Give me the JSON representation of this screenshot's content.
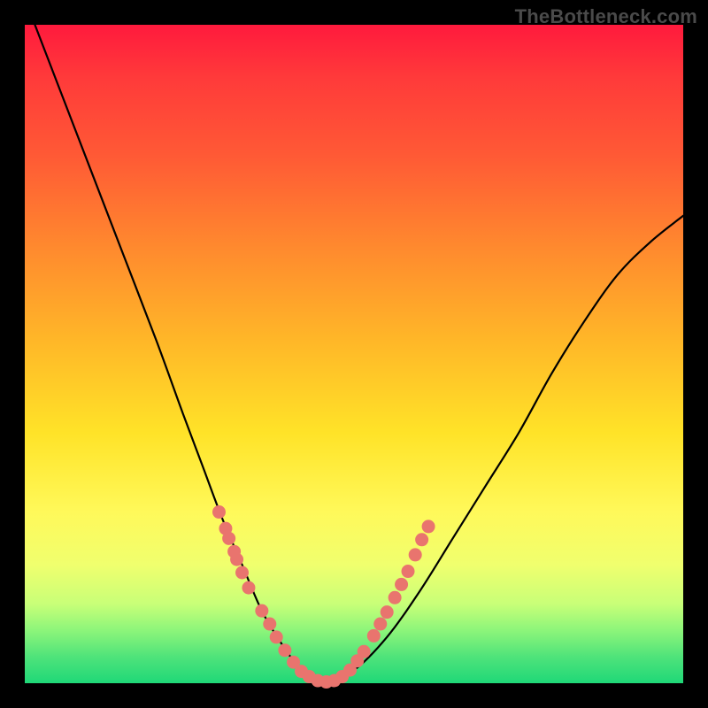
{
  "watermark": "TheBottleneck.com",
  "chart_data": {
    "type": "line",
    "title": "",
    "xlabel": "",
    "ylabel": "",
    "xlim": [
      0,
      1
    ],
    "ylim": [
      0,
      1
    ],
    "series": [
      {
        "name": "bottleneck-curve",
        "x": [
          0.0,
          0.05,
          0.1,
          0.15,
          0.2,
          0.24,
          0.27,
          0.3,
          0.33,
          0.36,
          0.39,
          0.42,
          0.45,
          0.5,
          0.55,
          0.6,
          0.65,
          0.7,
          0.75,
          0.8,
          0.85,
          0.9,
          0.95,
          1.0
        ],
        "y": [
          1.04,
          0.91,
          0.78,
          0.65,
          0.52,
          0.41,
          0.33,
          0.25,
          0.18,
          0.11,
          0.06,
          0.02,
          0.0,
          0.02,
          0.07,
          0.14,
          0.22,
          0.3,
          0.38,
          0.47,
          0.55,
          0.62,
          0.67,
          0.71
        ]
      }
    ],
    "highlight_dots": {
      "name": "near-minimum-band",
      "color": "#e9746e",
      "points": [
        {
          "x": 0.295,
          "y": 0.26
        },
        {
          "x": 0.305,
          "y": 0.235
        },
        {
          "x": 0.31,
          "y": 0.22
        },
        {
          "x": 0.318,
          "y": 0.2
        },
        {
          "x": 0.322,
          "y": 0.188
        },
        {
          "x": 0.33,
          "y": 0.168
        },
        {
          "x": 0.34,
          "y": 0.145
        },
        {
          "x": 0.36,
          "y": 0.11
        },
        {
          "x": 0.372,
          "y": 0.09
        },
        {
          "x": 0.382,
          "y": 0.07
        },
        {
          "x": 0.395,
          "y": 0.05
        },
        {
          "x": 0.408,
          "y": 0.032
        },
        {
          "x": 0.42,
          "y": 0.018
        },
        {
          "x": 0.432,
          "y": 0.01
        },
        {
          "x": 0.445,
          "y": 0.004
        },
        {
          "x": 0.458,
          "y": 0.002
        },
        {
          "x": 0.47,
          "y": 0.004
        },
        {
          "x": 0.482,
          "y": 0.01
        },
        {
          "x": 0.494,
          "y": 0.02
        },
        {
          "x": 0.505,
          "y": 0.034
        },
        {
          "x": 0.515,
          "y": 0.048
        },
        {
          "x": 0.53,
          "y": 0.072
        },
        {
          "x": 0.54,
          "y": 0.09
        },
        {
          "x": 0.55,
          "y": 0.108
        },
        {
          "x": 0.562,
          "y": 0.13
        },
        {
          "x": 0.572,
          "y": 0.15
        },
        {
          "x": 0.582,
          "y": 0.17
        },
        {
          "x": 0.593,
          "y": 0.195
        },
        {
          "x": 0.603,
          "y": 0.218
        },
        {
          "x": 0.613,
          "y": 0.238
        }
      ]
    }
  }
}
